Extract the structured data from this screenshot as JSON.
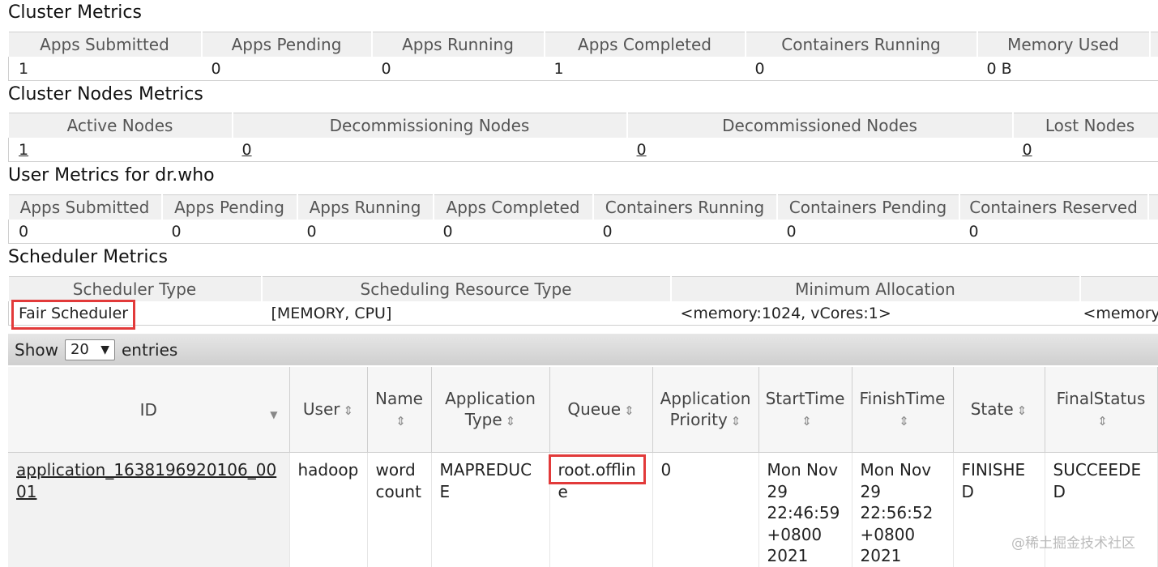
{
  "cluster_metrics": {
    "title": "Cluster Metrics",
    "headers": [
      "Apps Submitted",
      "Apps Pending",
      "Apps Running",
      "Apps Completed",
      "Containers Running",
      "Memory Used"
    ],
    "values": [
      "1",
      "0",
      "0",
      "1",
      "0",
      "0 B"
    ]
  },
  "cluster_nodes_metrics": {
    "title": "Cluster Nodes Metrics",
    "headers": [
      "Active Nodes",
      "Decommissioning Nodes",
      "Decommissioned Nodes",
      "Lost Nodes"
    ],
    "values": [
      "1",
      "0",
      "0",
      "0"
    ]
  },
  "user_metrics": {
    "title": "User Metrics for dr.who",
    "headers": [
      "Apps Submitted",
      "Apps Pending",
      "Apps Running",
      "Apps Completed",
      "Containers Running",
      "Containers Pending",
      "Containers Reserved"
    ],
    "values": [
      "0",
      "0",
      "0",
      "0",
      "0",
      "0",
      "0",
      "("
    ]
  },
  "scheduler_metrics": {
    "title": "Scheduler Metrics",
    "headers": [
      "Scheduler Type",
      "Scheduling Resource Type",
      "Minimum Allocation"
    ],
    "values": [
      "Fair Scheduler",
      "[MEMORY, CPU]",
      "<memory:1024, vCores:1>",
      "<memory"
    ]
  },
  "datatable": {
    "show_label": "Show",
    "entries_value": "20",
    "entries_label": "entries"
  },
  "apps_table": {
    "headers": {
      "id": "ID",
      "user": "User",
      "name": "Name",
      "app_type": "Application Type",
      "queue": "Queue",
      "priority": "Application Priority",
      "start": "StartTime",
      "finish": "FinishTime",
      "state": "State",
      "final_status": "FinalStatus"
    },
    "rows": [
      {
        "id": "application_1638196920106_0001",
        "user": "hadoop",
        "name": "word count",
        "app_type": "MAPREDUCE",
        "queue": "root.offline",
        "priority": "0",
        "start": "Mon Nov 29 22:46:59 +0800 2021",
        "finish": "Mon Nov 29 22:56:52 +0800 2021",
        "state": "FINISHED",
        "final_status": "SUCCEEDED"
      }
    ]
  },
  "watermark": "@稀土掘金技术社区",
  "highlight_color": "#e23a3a"
}
